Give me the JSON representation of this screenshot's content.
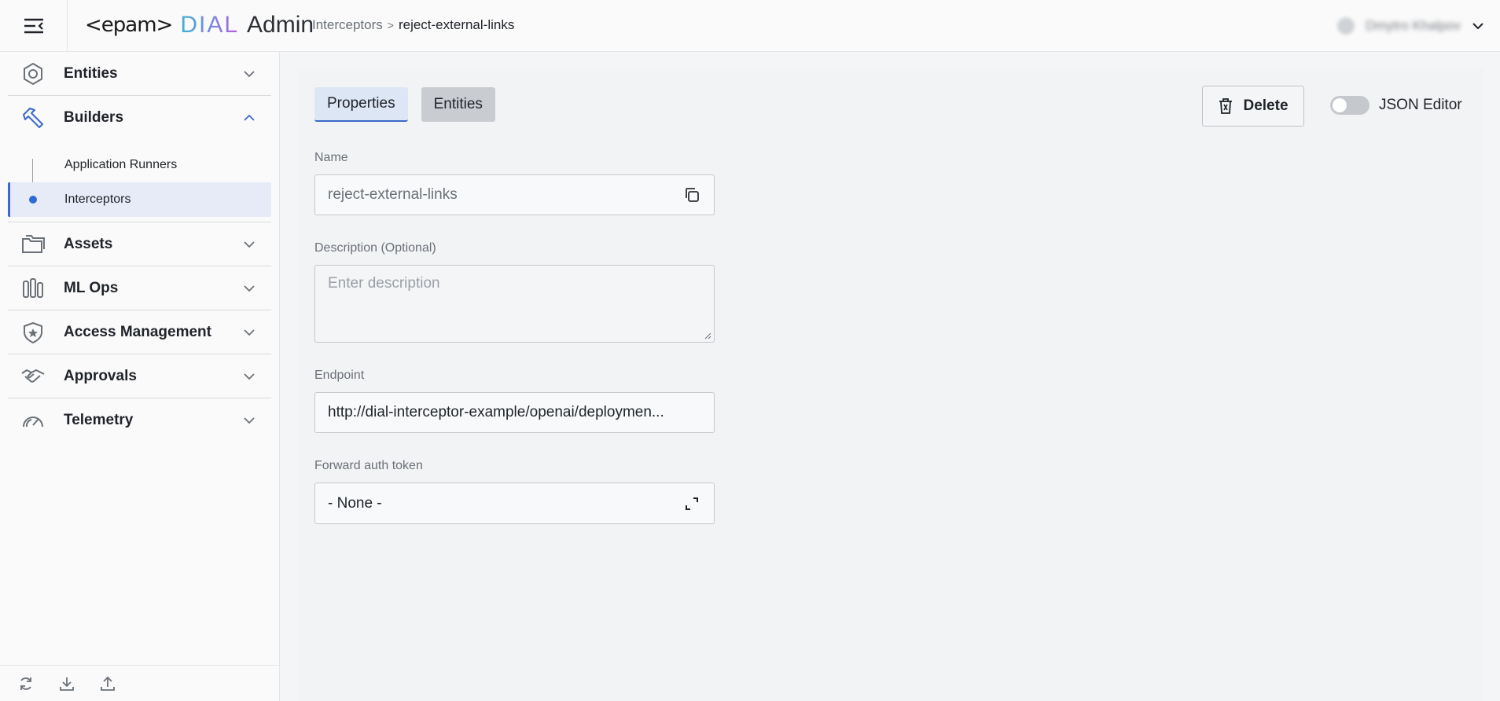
{
  "header": {
    "logo_epam": "<epam>",
    "logo_dial": "DIAL",
    "logo_admin": "Admin",
    "breadcrumb": {
      "parent": "Interceptors",
      "separator": ">",
      "current": "reject-external-links"
    },
    "user_name": "Dmytro Khalpov"
  },
  "sidebar": {
    "groups": [
      {
        "label": "Entities",
        "icon": "hexagon-icon",
        "expanded": false
      },
      {
        "label": "Builders",
        "icon": "hammer-icon",
        "expanded": true,
        "items": [
          {
            "label": "Application Runners",
            "active": false
          },
          {
            "label": "Interceptors",
            "active": true
          }
        ]
      },
      {
        "label": "Assets",
        "icon": "folders-icon",
        "expanded": false
      },
      {
        "label": "ML Ops",
        "icon": "mlops-icon",
        "expanded": false
      },
      {
        "label": "Access Management",
        "icon": "shield-star-icon",
        "expanded": false
      },
      {
        "label": "Approvals",
        "icon": "handshake-icon",
        "expanded": false
      },
      {
        "label": "Telemetry",
        "icon": "gauge-icon",
        "expanded": false
      }
    ],
    "footer_icons": [
      "refresh-icon",
      "download-icon",
      "upload-icon"
    ]
  },
  "main": {
    "tabs": [
      {
        "label": "Properties",
        "active": true
      },
      {
        "label": "Entities",
        "active": false
      }
    ],
    "delete_label": "Delete",
    "json_editor_label": "JSON Editor",
    "json_editor_on": false,
    "fields": {
      "name": {
        "label": "Name",
        "value": "reject-external-links"
      },
      "description": {
        "label": "Description (Optional)",
        "placeholder": "Enter description",
        "value": ""
      },
      "endpoint": {
        "label": "Endpoint",
        "value": "http://dial-interceptor-example/openai/deploymen..."
      },
      "forward_auth": {
        "label": "Forward auth token",
        "value": "- None -"
      }
    }
  },
  "colors": {
    "accent": "#3c6ac8",
    "active_item_bg": "#e6ebf7",
    "active_dot": "#2f6bd6"
  }
}
